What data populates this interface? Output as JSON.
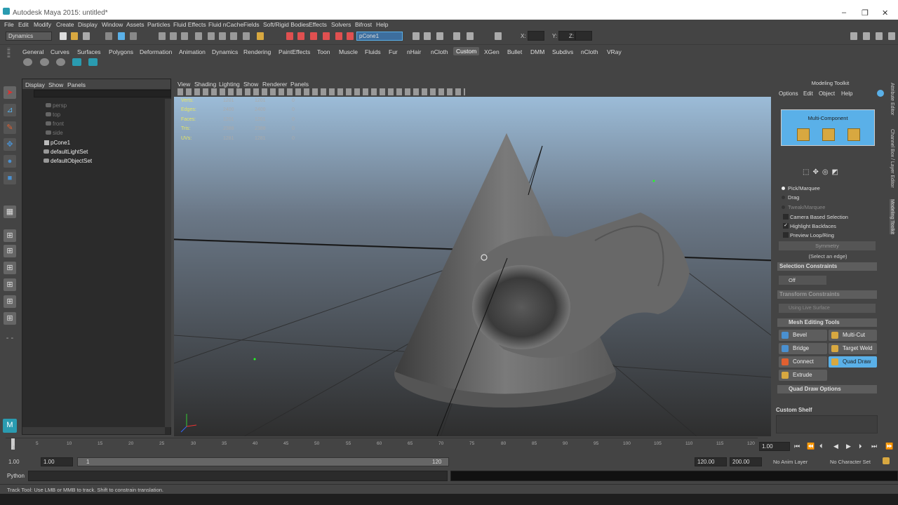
{
  "window": {
    "title": "Autodesk Maya 2015: untitled*",
    "minimize": "–",
    "restore": "❐",
    "close": "✕"
  },
  "menu": [
    "File",
    "Edit",
    "Modify",
    "Create",
    "Display",
    "Window",
    "Assets",
    "Particles",
    "Fluid Effects",
    "Fluid nCache",
    "Fields",
    "Soft/Rigid Bodies",
    "Effects",
    "Solvers",
    "Bifrost",
    "Help"
  ],
  "status": {
    "mode": "Dynamics",
    "object_field": "pCone1",
    "x": "X:",
    "y": "Y:",
    "z": "Z:"
  },
  "shelf_tabs": [
    "General",
    "Curves",
    "Surfaces",
    "Polygons",
    "Deformation",
    "Animation",
    "Dynamics",
    "Rendering",
    "PaintEffects",
    "Toon",
    "Muscle",
    "Fluids",
    "Fur",
    "nHair",
    "nCloth",
    "Custom",
    "XGen",
    "Bullet",
    "DMM",
    "Subdivs",
    "nCloth",
    "VRay"
  ],
  "shelf_active": "Custom",
  "outliner": {
    "menu": [
      "Display",
      "Show",
      "Panels"
    ],
    "items": [
      {
        "label": "persp",
        "dim": true
      },
      {
        "label": "top",
        "dim": true
      },
      {
        "label": "front",
        "dim": true
      },
      {
        "label": "side",
        "dim": true
      },
      {
        "label": "pCone1",
        "dim": false
      },
      {
        "label": "defaultLightSet",
        "dim": false
      },
      {
        "label": "defaultObjectSet",
        "dim": false
      }
    ]
  },
  "viewport": {
    "menu": [
      "View",
      "Shading",
      "Lighting",
      "Show",
      "Renderer",
      "Panels"
    ],
    "hud": [
      {
        "label": "Verts:",
        "a": "1201",
        "b": "1201",
        "c": "0"
      },
      {
        "label": "Edges:",
        "a": "2400",
        "b": "2400",
        "c": "0"
      },
      {
        "label": "Faces:",
        "a": "1201",
        "b": "1201",
        "c": "0"
      },
      {
        "label": "Tris:",
        "a": "2388",
        "b": "2388",
        "c": "0"
      },
      {
        "label": "UVs:",
        "a": "1281",
        "b": "1281",
        "c": "0"
      }
    ]
  },
  "toolkit": {
    "title": "Modeling Toolkit",
    "menu": [
      "Options",
      "Edit",
      "Object",
      "Help"
    ],
    "multi_component": "Multi-Component",
    "pick_options": [
      {
        "label": "Pick/Marquee",
        "on": true,
        "dim": false
      },
      {
        "label": "Drag",
        "on": false,
        "dim": false
      },
      {
        "label": "Tweak/Marquee",
        "on": false,
        "dim": true
      }
    ],
    "checks": [
      {
        "label": "Camera Based Selection",
        "checked": false
      },
      {
        "label": "Highlight Backfaces",
        "checked": true
      },
      {
        "label": "Preview Loop/Ring",
        "checked": false
      }
    ],
    "symmetry": "Symmetry",
    "select_edge": "(Select an edge)",
    "selection_constraints": "Selection Constraints",
    "off": "Off",
    "transform_constraints": "Transform Constraints",
    "using_live_surface": "Using Live Surface",
    "mesh_editing_tools": "Mesh Editing Tools",
    "tools": [
      {
        "label": "Bevel",
        "color": "#4a90d0",
        "sel": false
      },
      {
        "label": "Multi-Cut",
        "color": "#d8a840",
        "sel": false
      },
      {
        "label": "Bridge",
        "color": "#4a90d0",
        "sel": false
      },
      {
        "label": "Target Weld",
        "color": "#d8a840",
        "sel": false
      },
      {
        "label": "Connect",
        "color": "#e06030",
        "sel": false
      },
      {
        "label": "Quad Draw",
        "color": "#d8a840",
        "sel": true
      },
      {
        "label": "Extrude",
        "color": "#d8a840",
        "sel": false
      }
    ],
    "quad_draw_options": "Quad Draw Options",
    "custom_shelf": "Custom Shelf"
  },
  "side_tabs": [
    "Attribute Editor",
    "Channel Box / Layer Editor",
    "Modeling Toolkit"
  ],
  "timeline": {
    "ticks": [
      "1",
      "5",
      "10",
      "15",
      "20",
      "25",
      "30",
      "35",
      "40",
      "45",
      "50",
      "55",
      "60",
      "65",
      "70",
      "75",
      "80",
      "85",
      "90",
      "95",
      "100",
      "105",
      "110",
      "115",
      "120"
    ],
    "current": "1.00"
  },
  "range": {
    "start": "1.00",
    "start2": "1.00",
    "slider_start": "1",
    "slider_end": "120",
    "end": "120.00",
    "end2": "200.00",
    "anim_layer": "No Anim Layer",
    "char_set": "No Character Set"
  },
  "command": {
    "lang": "Python"
  },
  "help_line": "Track Tool: Use LMB or MMB to track. Shift to constrain translation.",
  "colors": {
    "accent": "#5ab0e8",
    "panel": "#444444",
    "field": "#2b2b2b",
    "hud": "#e8e860"
  }
}
